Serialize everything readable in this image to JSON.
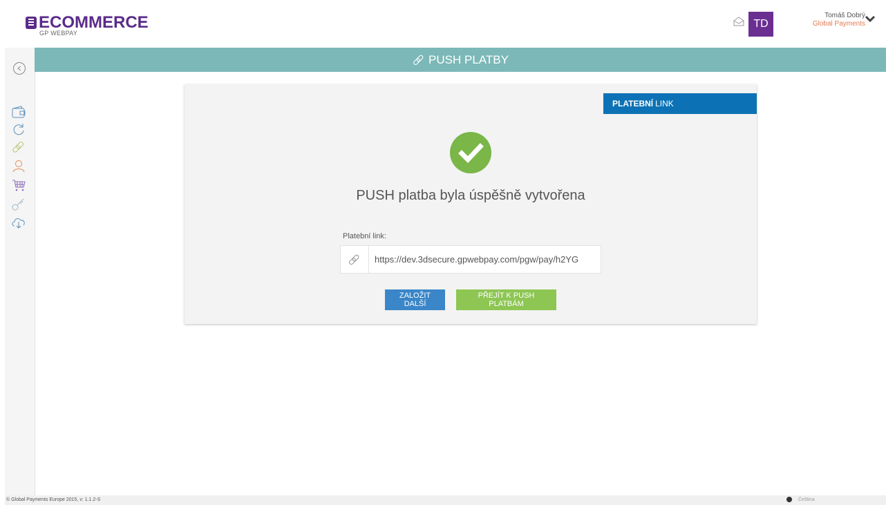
{
  "header": {
    "logo_text": "ECOMMERCE",
    "logo_sub": "GP WEBPAY",
    "avatar_initials": "TD",
    "user_name": "Tomáš Dobrý",
    "user_company": "Global Payments"
  },
  "page": {
    "title": "PUSH PLATBY"
  },
  "card": {
    "tab_bold": "PLATEBNÍ",
    "tab_rest": "LINK",
    "success_message": "PUSH platba byla úspěšně vytvořena",
    "link_label": "Platební link:",
    "link_value": "https://dev.3dsecure.gpwebpay.com/pgw/pay/h2YG",
    "create_another_label": "ZALOŽIT DALŠÍ",
    "go_to_push_label": "PŘEJÍT K PUSH PLATBÁM"
  },
  "footer": {
    "copyright": "© Global Payments Europe 2015, v: 1.1.2-S",
    "language": "Čeština"
  },
  "colors": {
    "brand": "#5b2b8a",
    "titlebar": "#7cb8b7",
    "tab": "#0c72b5",
    "success": "#7ab648",
    "button_blue": "#3a86c8",
    "button_green": "#8dc653"
  }
}
